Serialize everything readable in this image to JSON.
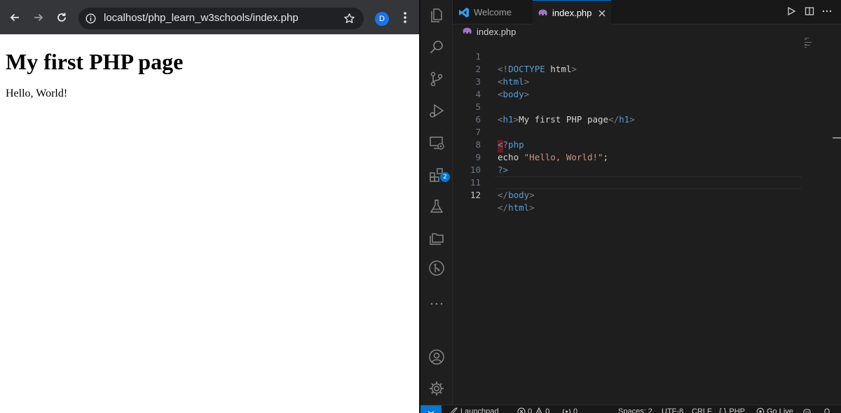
{
  "browser": {
    "url": "localhost/php_learn_w3schools/index.php",
    "profile_initial": "D",
    "page": {
      "heading": "My first PHP page",
      "body_text": "Hello, World!"
    }
  },
  "vscode": {
    "tabs": [
      {
        "label": "Welcome",
        "icon": "vscode-logo-icon",
        "active": false
      },
      {
        "label": "index.php",
        "icon": "php-elephant-icon",
        "active": true
      }
    ],
    "breadcrumb": "index.php",
    "extensions_badge": "2",
    "code_lines": [
      {
        "num": "1",
        "text": "<!DOCTYPE html>"
      },
      {
        "num": "2",
        "text": "<html>"
      },
      {
        "num": "3",
        "text": "<body>"
      },
      {
        "num": "4",
        "text": ""
      },
      {
        "num": "5",
        "text": "<h1>My first PHP page</h1>"
      },
      {
        "num": "6",
        "text": ""
      },
      {
        "num": "7",
        "text": "<?php"
      },
      {
        "num": "8",
        "text": "echo \"Hello, World!\";"
      },
      {
        "num": "9",
        "text": "?>"
      },
      {
        "num": "10",
        "text": ""
      },
      {
        "num": "11",
        "text": "</body>"
      },
      {
        "num": "12",
        "text": "</html>"
      }
    ],
    "status": {
      "launchpad": "Launchpad",
      "errors": "0",
      "warnings": "0",
      "ports": "0",
      "spaces": "Spaces: 2",
      "encoding": "UTF-8",
      "eol": "CRLF",
      "language": "PHP",
      "golive": "Go Live"
    },
    "colors": {
      "accent": "#0078d4",
      "tag": "#569cd6",
      "string": "#ce9178"
    }
  }
}
